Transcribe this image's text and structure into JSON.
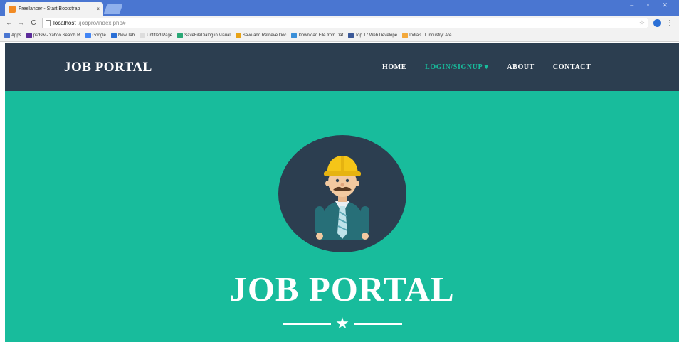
{
  "browser": {
    "tab_title": "Freelancer - Start Bootstrap",
    "tab_close": "×",
    "url_host": "localhost",
    "url_path": "/jobpro/index.php#",
    "back": "←",
    "forward": "→",
    "reload": "C",
    "menu": "⋮",
    "star": "☆",
    "window_controls": "– ▫ ✕",
    "bookmarks": [
      {
        "label": "Apps",
        "color": "#4a76d1"
      },
      {
        "label": "psdsw - Yahoo Search R",
        "color": "#5b2b9a"
      },
      {
        "label": "Google",
        "color": "#4285f4"
      },
      {
        "label": "New Tab",
        "color": "#2a6fd6"
      },
      {
        "label": "Untitled Page",
        "color": "#dddddd"
      },
      {
        "label": "SaveFileDialog in Visual",
        "color": "#2aa876"
      },
      {
        "label": "Save and Retrieve Doc",
        "color": "#e8a317"
      },
      {
        "label": "Download File from Dat",
        "color": "#3a8fd8"
      },
      {
        "label": "Top 17 Web Develope",
        "color": "#3b5998"
      },
      {
        "label": "India's IT Industry: Are",
        "color": "#f3a83b"
      }
    ]
  },
  "site": {
    "brand": "JOB PORTAL",
    "nav": [
      {
        "label": "HOME",
        "active": false
      },
      {
        "label": "LOGIN/SIGNUP ▾",
        "active": true
      },
      {
        "label": "ABOUT",
        "active": false
      },
      {
        "label": "CONTACT",
        "active": false
      }
    ],
    "hero_title": "JOB PORTAL",
    "divider_icon": "★"
  },
  "colors": {
    "navbar": "#2c3e50",
    "hero": "#18bc9c",
    "accent": "#18bc9c"
  }
}
